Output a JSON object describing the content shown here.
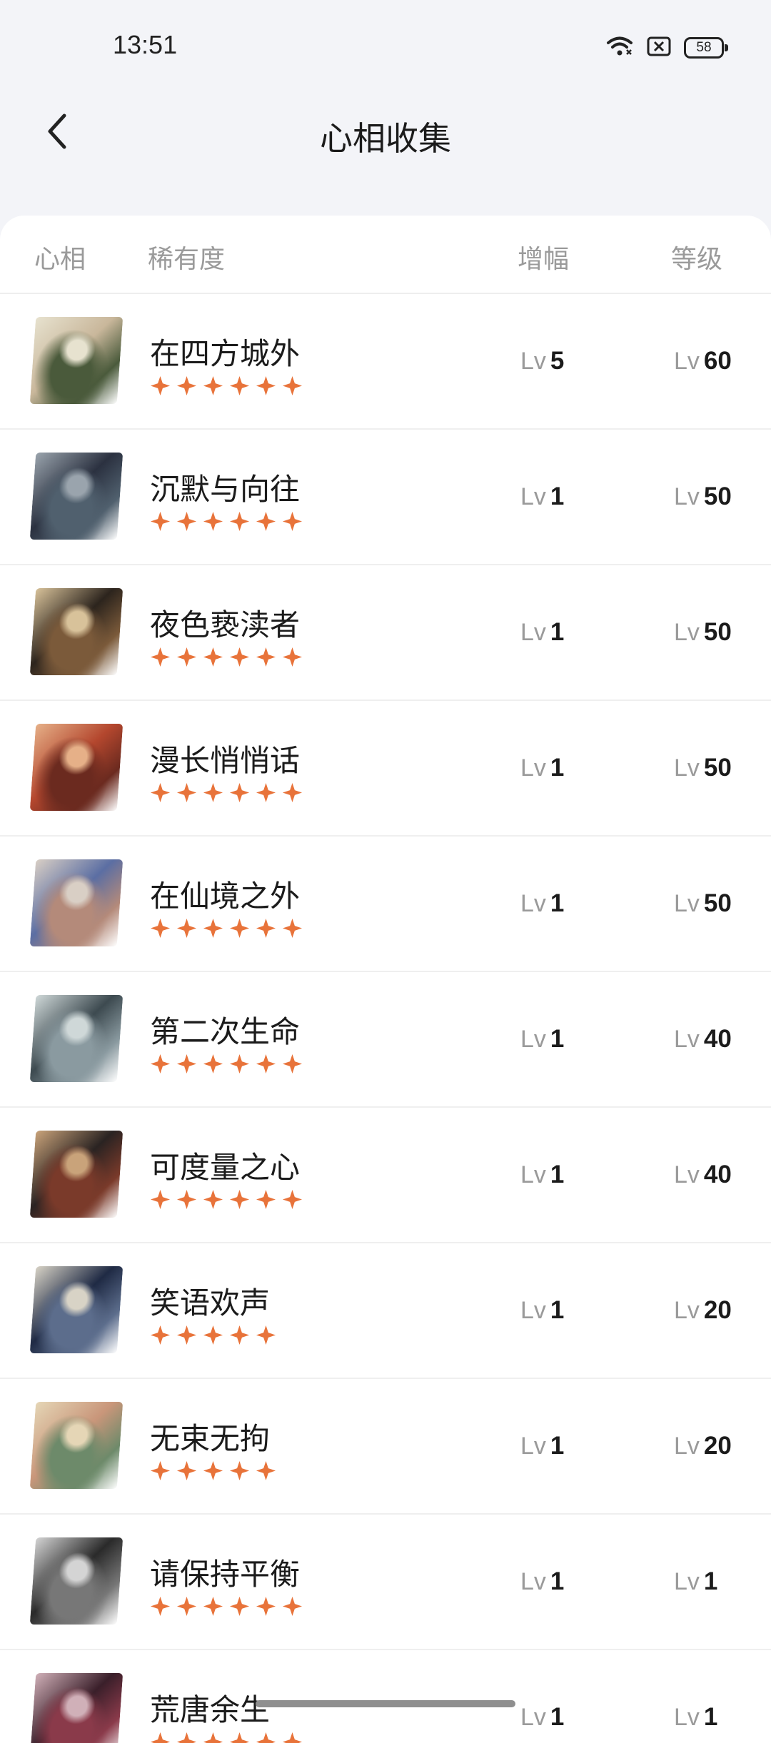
{
  "status_bar": {
    "time": "13:51",
    "battery": "58",
    "icons": [
      "wifi-icon",
      "sim-off-icon",
      "battery-icon"
    ]
  },
  "header": {
    "title": "心相收集",
    "back_icon": "chevron-left-icon"
  },
  "table": {
    "columns": {
      "xinxiang": "心相",
      "rarity": "稀有度",
      "boost": "增幅",
      "level": "等级"
    },
    "lv_prefix": "Lv",
    "star_color": "#e8733a",
    "rows": [
      {
        "name": "在四方城外",
        "stars": 6,
        "boost": "5",
        "level": "60",
        "avatar_colors": [
          "#c9b79b",
          "#4a5a3b",
          "#e7e2cf"
        ]
      },
      {
        "name": "沉默与向往",
        "stars": 6,
        "boost": "1",
        "level": "50",
        "avatar_colors": [
          "#2b3140",
          "#50606e",
          "#9aa4ad"
        ]
      },
      {
        "name": "夜色亵渎者",
        "stars": 6,
        "boost": "1",
        "level": "50",
        "avatar_colors": [
          "#2c241d",
          "#7b5a3a",
          "#d8c29a"
        ]
      },
      {
        "name": "漫长悄悄话",
        "stars": 6,
        "boost": "1",
        "level": "50",
        "avatar_colors": [
          "#b4472e",
          "#6b2a1f",
          "#e6b088"
        ]
      },
      {
        "name": "在仙境之外",
        "stars": 6,
        "boost": "1",
        "level": "50",
        "avatar_colors": [
          "#5b6ea3",
          "#b48a7a",
          "#d9cfc5"
        ]
      },
      {
        "name": "第二次生命",
        "stars": 6,
        "boost": "1",
        "level": "40",
        "avatar_colors": [
          "#3d4a50",
          "#8a9aa0",
          "#cfd8d8"
        ]
      },
      {
        "name": "可度量之心",
        "stars": 6,
        "boost": "1",
        "level": "40",
        "avatar_colors": [
          "#2a2322",
          "#7a3a2a",
          "#c9a37a"
        ]
      },
      {
        "name": "笑语欢声",
        "stars": 5,
        "boost": "1",
        "level": "20",
        "avatar_colors": [
          "#1f2a44",
          "#5c6d8c",
          "#d8d3c6"
        ]
      },
      {
        "name": "无束无拘",
        "stars": 5,
        "boost": "1",
        "level": "20",
        "avatar_colors": [
          "#c9967a",
          "#6d8a6a",
          "#e5d6b6"
        ]
      },
      {
        "name": "请保持平衡",
        "stars": 6,
        "boost": "1",
        "level": "1",
        "avatar_colors": [
          "#2a2a2a",
          "#777777",
          "#d4d4d4"
        ]
      },
      {
        "name": "荒唐余生",
        "stars": 6,
        "boost": "1",
        "level": "1",
        "avatar_colors": [
          "#3a1f2a",
          "#8a3a4a",
          "#d0b0b8"
        ]
      }
    ]
  }
}
